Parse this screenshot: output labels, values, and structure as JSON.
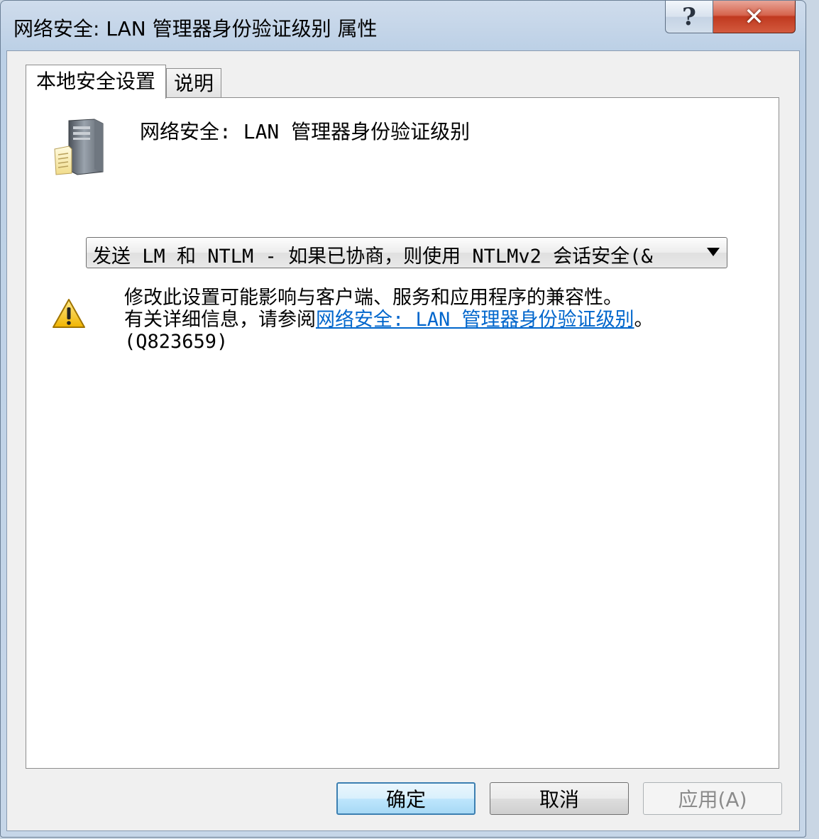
{
  "window": {
    "title": "网络安全: LAN 管理器身份验证级别 属性",
    "help_glyph": "?",
    "close_glyph": "✕"
  },
  "tabs": [
    {
      "label": "本地安全设置",
      "active": true
    },
    {
      "label": "说明",
      "active": false
    }
  ],
  "policy": {
    "icon": "server-document-icon",
    "name": "网络安全: LAN 管理器身份验证级别"
  },
  "dropdown": {
    "selected": "发送 LM 和 NTLM - 如果已协商，则使用 NTLMv2 会话安全(&"
  },
  "warning": {
    "icon": "warning-icon",
    "line1": "修改此设置可能影响与客户端、服务和应用程序的兼容性。",
    "line2_prefix": "有关详细信息，请参阅",
    "link_text": "网络安全: LAN 管理器身份验证级别",
    "line2_suffix": "。",
    "line3": "(Q823659)"
  },
  "buttons": {
    "ok": "确定",
    "cancel": "取消",
    "apply": "应用(A)"
  },
  "colors": {
    "link": "#0066cc",
    "close_button": "#c0391f",
    "default_button_border": "#3c7fb1"
  }
}
